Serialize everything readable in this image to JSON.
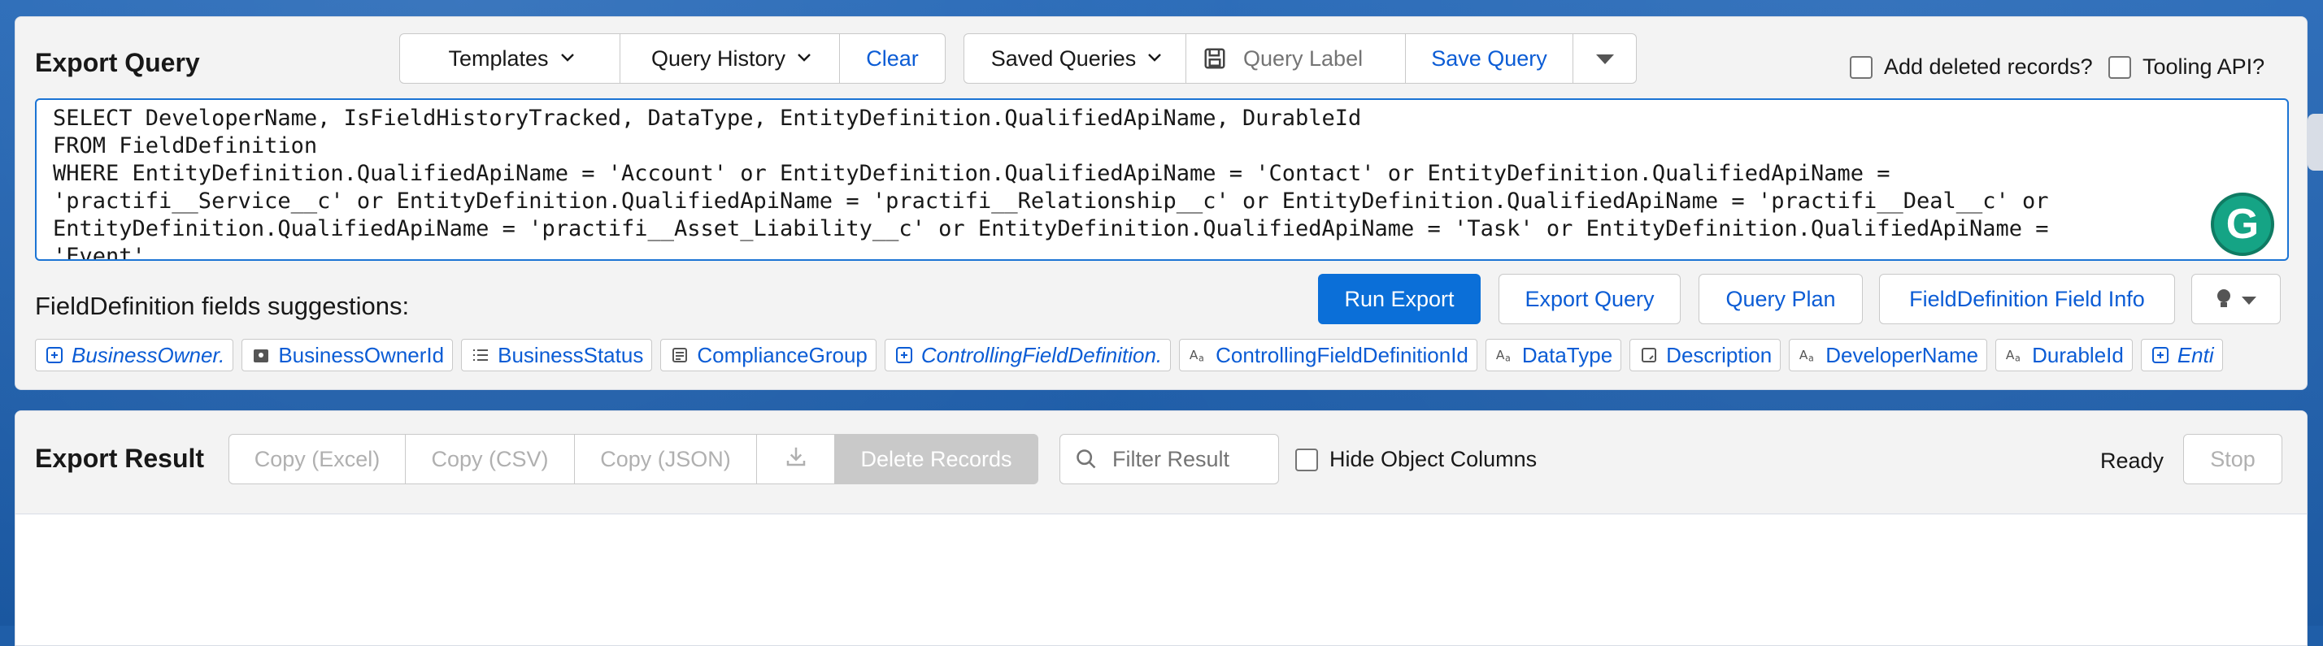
{
  "query": {
    "title": "Export Query",
    "toolbar": {
      "templates": "Templates",
      "query_history": "Query History",
      "clear": "Clear",
      "saved_queries": "Saved Queries",
      "query_label_placeholder": "Query Label",
      "save_query": "Save Query"
    },
    "options": {
      "add_deleted": "Add deleted records?",
      "tooling_api": "Tooling API?"
    },
    "soql": "SELECT DeveloperName, IsFieldHistoryTracked, DataType, EntityDefinition.QualifiedApiName, DurableId\nFROM FieldDefinition\nWHERE EntityDefinition.QualifiedApiName = 'Account' or EntityDefinition.QualifiedApiName = 'Contact' or EntityDefinition.QualifiedApiName =\n'practifi__Service__c' or EntityDefinition.QualifiedApiName = 'practifi__Relationship__c' or EntityDefinition.QualifiedApiName = 'practifi__Deal__c' or\nEntityDefinition.QualifiedApiName = 'practifi__Asset_Liability__c' or EntityDefinition.QualifiedApiName = 'Task' or EntityDefinition.QualifiedApiName =\n'Event'",
    "actions": {
      "run_export": "Run Export",
      "export_query": "Export Query",
      "query_plan": "Query Plan",
      "field_info": "FieldDefinition Field Info"
    },
    "suggestions_title": "FieldDefinition fields suggestions:",
    "suggestions": [
      {
        "label": "BusinessOwner.",
        "icon": "lookup-icon",
        "italic": true
      },
      {
        "label": "BusinessOwnerId",
        "icon": "id-icon",
        "italic": false
      },
      {
        "label": "BusinessStatus",
        "icon": "picklist-icon",
        "italic": false
      },
      {
        "label": "ComplianceGroup",
        "icon": "multipicklist-icon",
        "italic": false
      },
      {
        "label": "ControllingFieldDefinition.",
        "icon": "lookup-icon",
        "italic": true
      },
      {
        "label": "ControllingFieldDefinitionId",
        "icon": "text-icon",
        "italic": false
      },
      {
        "label": "DataType",
        "icon": "text-icon",
        "italic": false
      },
      {
        "label": "Description",
        "icon": "textarea-icon",
        "italic": false
      },
      {
        "label": "DeveloperName",
        "icon": "text-icon",
        "italic": false
      },
      {
        "label": "DurableId",
        "icon": "text-icon",
        "italic": false
      },
      {
        "label": "Enti",
        "icon": "lookup-icon",
        "italic": true
      }
    ]
  },
  "result": {
    "title": "Export Result",
    "copy_excel": "Copy (Excel)",
    "copy_csv": "Copy (CSV)",
    "copy_json": "Copy (JSON)",
    "delete_records": "Delete Records",
    "filter_placeholder": "Filter Result",
    "hide_object_columns": "Hide Object Columns",
    "status": "Ready",
    "stop": "Stop"
  },
  "colors": {
    "brand": "#0b6fd8",
    "link": "#0b5cd5",
    "grammarly": "#15a485"
  }
}
